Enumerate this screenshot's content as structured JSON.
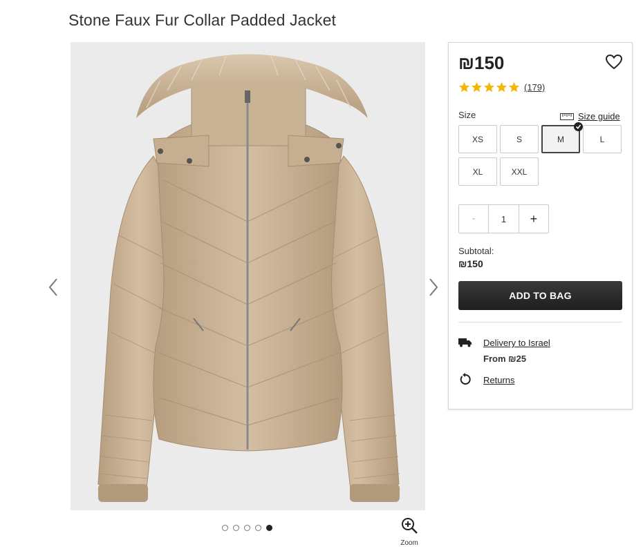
{
  "product": {
    "title": "Stone Faux Fur Collar Padded Jacket",
    "price": "₪150",
    "rating": {
      "stars": 5,
      "reviews": "(179)"
    }
  },
  "gallery": {
    "image_alt": "Stone faux fur collar padded jacket",
    "total_images": 5,
    "active_index": 4,
    "zoom_label": "Zoom"
  },
  "sizes": {
    "label": "Size",
    "guide_label": "Size guide",
    "options": [
      "XS",
      "S",
      "M",
      "L",
      "XL",
      "XXL"
    ],
    "selected": "M"
  },
  "quantity": {
    "minus": "-",
    "value": "1",
    "plus": "+"
  },
  "subtotal": {
    "label": "Subtotal:",
    "value": "₪150"
  },
  "actions": {
    "add_to_bag": "ADD TO BAG"
  },
  "delivery": {
    "link": "Delivery to Israel",
    "from": "From ₪25"
  },
  "returns": {
    "link": "Returns"
  },
  "icons": {
    "heart": "heart-icon",
    "star": "star-icon",
    "ruler": "ruler-icon",
    "truck": "truck-icon",
    "returns": "returns-icon",
    "zoom": "zoom-in-icon"
  },
  "colors": {
    "star": "#f2b705",
    "button": "#222222",
    "jacket": "#cbb497",
    "fur": "#c7b094"
  }
}
